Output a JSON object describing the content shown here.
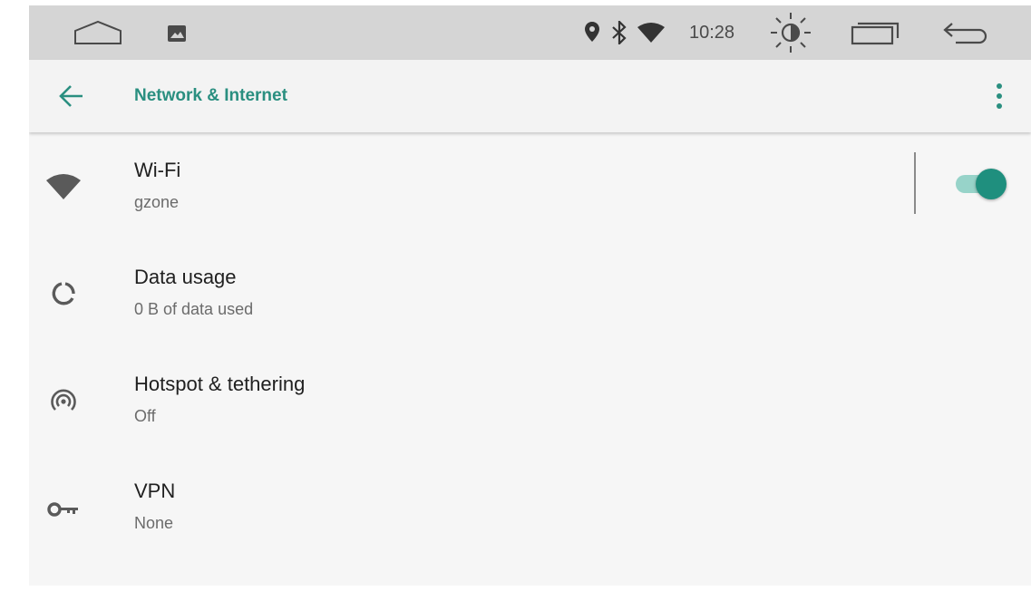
{
  "status_bar": {
    "time": "10:28",
    "icons": [
      "home-icon",
      "gallery-icon",
      "location-icon",
      "bluetooth-icon",
      "wifi-signal-icon",
      "brightness-icon",
      "recent-apps-icon",
      "back-nav-icon"
    ]
  },
  "app_bar": {
    "title": "Network & Internet",
    "back_icon": "arrow-left-icon",
    "menu_icon": "more-vertical-icon"
  },
  "items": [
    {
      "title": "Wi-Fi",
      "subtitle": "gzone",
      "icon": "wifi-icon",
      "toggle": true
    },
    {
      "title": "Data usage",
      "subtitle": "0 B of data used",
      "icon": "data-usage-icon"
    },
    {
      "title": "Hotspot & tethering",
      "subtitle": "Off",
      "icon": "hotspot-icon"
    },
    {
      "title": "VPN",
      "subtitle": "None",
      "icon": "vpn-key-icon"
    }
  ],
  "colors": {
    "accent": "#2a8f80",
    "switch_thumb": "#1f8f7e",
    "switch_track": "#97d3c9",
    "status_bar_bg": "#d5d5d5",
    "background": "#f6f6f6"
  }
}
